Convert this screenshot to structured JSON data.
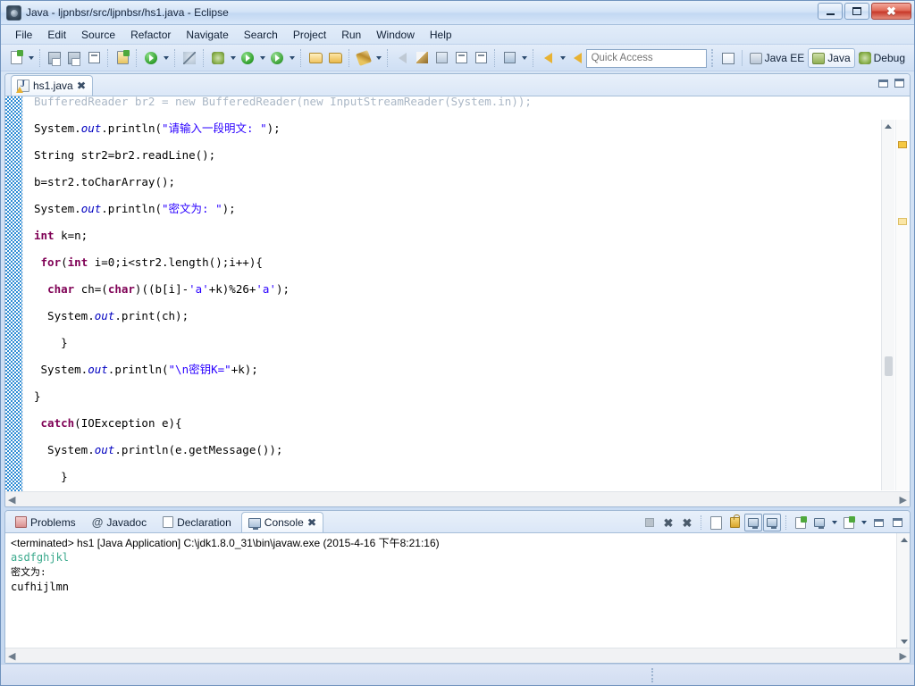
{
  "window": {
    "title": "Java - ljpnbsr/src/ljpnbsr/hs1.java - Eclipse",
    "app_icon": "eclipse-icon",
    "buttons": {
      "minimize": "minimize",
      "restore": "restore",
      "close": "close"
    }
  },
  "menubar": {
    "items": [
      "File",
      "Edit",
      "Source",
      "Refactor",
      "Navigate",
      "Search",
      "Project",
      "Run",
      "Window",
      "Help"
    ]
  },
  "toolbar": {
    "icons": [
      "new-wizard-icon",
      "new-dropdown-arrow",
      "save-icon",
      "save-all-icon",
      "print-icon",
      "new-java-package-icon",
      "refresh-icon",
      "refresh-dropdown-arrow",
      "skip-breakpoints-icon",
      "debug-icon",
      "debug-dropdown-arrow",
      "run-icon",
      "run-dropdown-arrow",
      "run-external-tools-icon",
      "external-tools-dropdown-arrow",
      "open-type-icon",
      "open-task-icon",
      "search-icon",
      "search-dropdown-arrow",
      "next-annotation-icon",
      "previous-annotation-icon",
      "last-edit-location-icon",
      "toggle-mark-occurrences-icon",
      "toggle-block-selection-icon",
      "restore-last-state-icon",
      "restore-dropdown-arrow",
      "back-icon",
      "back-dropdown-arrow",
      "forward-icon",
      "forward-dropdown-arrow",
      "next-icon"
    ]
  },
  "quick_access": {
    "placeholder": "Quick Access",
    "value": ""
  },
  "perspectives": {
    "open_perspective_icon": "open-perspective-icon",
    "items": [
      {
        "label": "Java EE",
        "icon": "java-ee-perspective-icon",
        "active": false
      },
      {
        "label": "Java",
        "icon": "java-perspective-icon",
        "active": true
      },
      {
        "label": "Debug",
        "icon": "debug-perspective-icon",
        "active": false
      }
    ]
  },
  "editor": {
    "tab": {
      "label": "hs1.java",
      "icon": "java-file-warning-icon",
      "close": "✖"
    },
    "view_controls": [
      "minimize-view-icon",
      "maximize-view-icon"
    ],
    "code_lines": [
      {
        "clipped": true,
        "text": "BufferedReader br2 = new BufferedReader(new InputStreamReader(System.in));"
      },
      {
        "text": "System.out.println(\"请输入一段明文: \");"
      },
      {
        "text": "String str2=br2.readLine();"
      },
      {
        "text": "b=str2.toCharArray();"
      },
      {
        "text": "System.out.println(\"密文为: \");"
      },
      {
        "text": "int k=n;"
      },
      {
        "text": " for(int i=0;i<str2.length();i++){"
      },
      {
        "text": "  char ch=(char)((b[i]-'a'+k)%26+'a');"
      },
      {
        "text": "  System.out.print(ch);"
      },
      {
        "text": "    }"
      },
      {
        "text": " System.out.println(\"\\n密钥K=\"+k);"
      },
      {
        "text": "}"
      },
      {
        "text": " catch(IOException e){"
      },
      {
        "text": "  System.out.println(e.getMessage());"
      },
      {
        "text": "    }"
      }
    ],
    "overview_markers": [
      "warning-marker",
      "warning-marker"
    ],
    "scroll": {
      "up_arrow": "▲",
      "down_arrow": "▼",
      "left_arrow": "◀",
      "right_arrow": "▶"
    }
  },
  "bottom_panel": {
    "tabs": [
      {
        "label": "Problems",
        "icon": "problems-icon",
        "active": false
      },
      {
        "label": "Javadoc",
        "icon": "javadoc-at-icon",
        "active": false
      },
      {
        "label": "Declaration",
        "icon": "declaration-icon",
        "active": false
      },
      {
        "label": "Console",
        "icon": "console-icon",
        "active": true,
        "close": "✖"
      }
    ],
    "tools": [
      "terminate-icon",
      "remove-launch-icon",
      "remove-all-terminated-icon",
      "clear-console-icon",
      "scroll-lock-icon",
      "show-console-on-output-icon",
      "show-console-on-error-icon",
      "pin-console-icon",
      "display-selected-console-icon",
      "display-console-dropdown-arrow",
      "open-console-icon",
      "open-console-dropdown-arrow",
      "minimize-view-icon",
      "maximize-view-icon"
    ],
    "console": {
      "header": "<terminated> hs1 [Java Application] C:\\jdk1.8.0_31\\bin\\javaw.exe (2015-4-16 下午8:21:16)",
      "lines": [
        {
          "text": "asdfghjkl",
          "stream": "input"
        },
        {
          "text": "密文为:",
          "stream": "output",
          "small": true
        },
        {
          "text": "cufhijlmn",
          "stream": "output"
        }
      ]
    }
  },
  "statusbar": {
    "text": "",
    "grip": "resize-grip"
  },
  "colors": {
    "keyword": "#7f0055",
    "string": "#2a00ff",
    "field": "#0000c0",
    "console_input": "#3aa98c",
    "accent_blue": "#2e8cd4",
    "chrome": "#cfdff4",
    "close_red": "#c7392a"
  }
}
